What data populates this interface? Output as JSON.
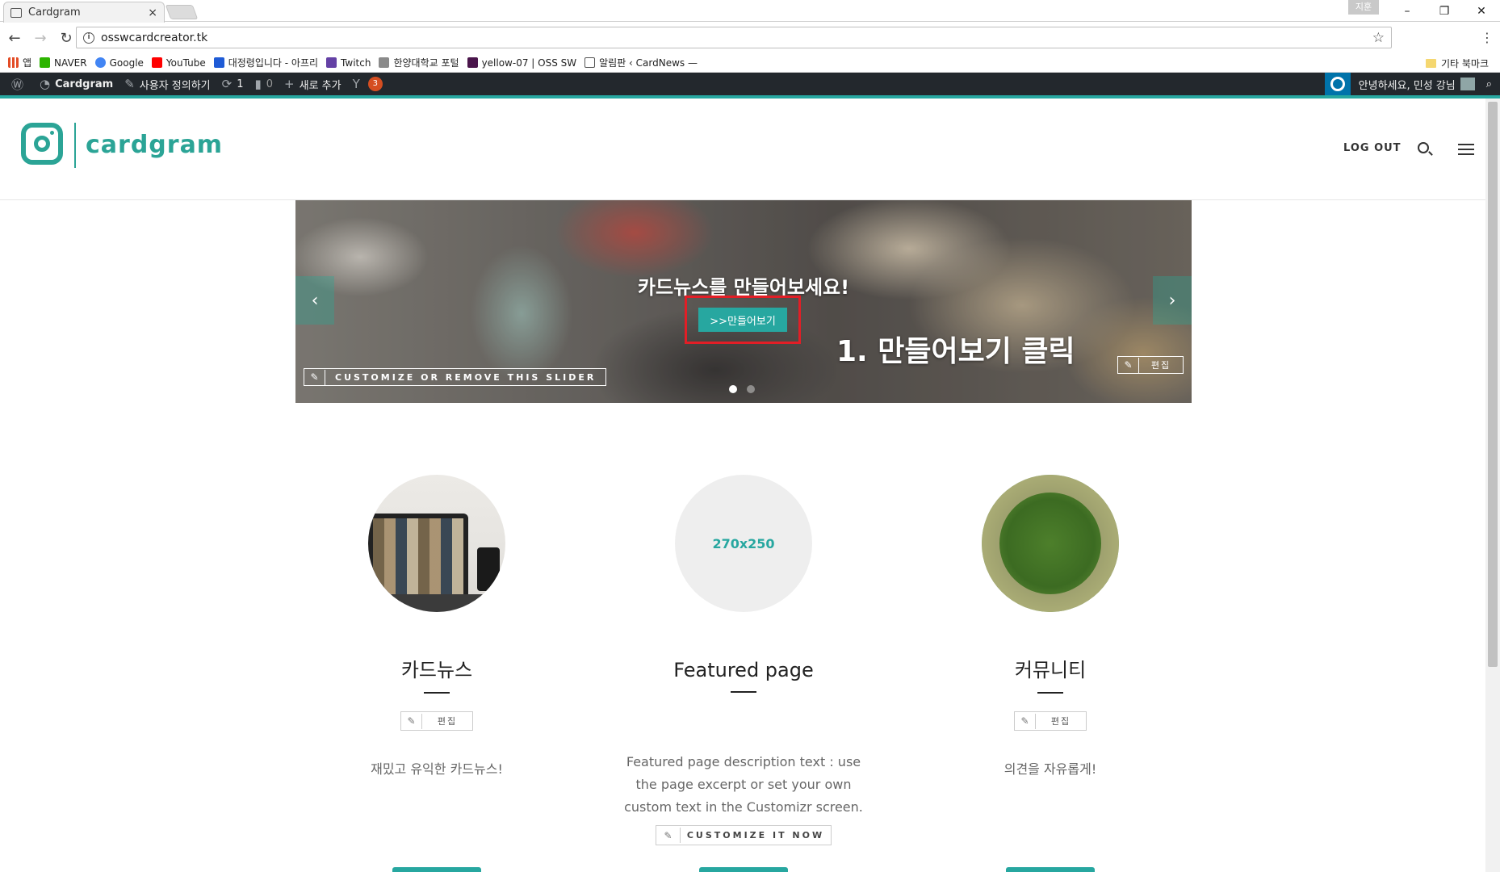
{
  "browser": {
    "tab_title": "Cardgram",
    "tab_close": "×",
    "profile_label": "지훈",
    "url": "osswcardcreator.tk",
    "bookmarks": [
      {
        "label": "앱",
        "color": "#e34c26"
      },
      {
        "label": "NAVER",
        "color": "#2db400"
      },
      {
        "label": "Google",
        "color": "#4285f4"
      },
      {
        "label": "YouTube",
        "color": "#ff0000"
      },
      {
        "label": "대정령입니다 - 아프리",
        "color": "#1f5bd6"
      },
      {
        "label": "Twitch",
        "color": "#6441a5"
      },
      {
        "label": "한양대학교 포털",
        "color": "#8a8a8a"
      },
      {
        "label": "yellow-07 | OSS SW",
        "color": "#4a154b"
      },
      {
        "label": "알림판 ‹ CardNews —",
        "color": "#555555"
      }
    ],
    "other_bookmarks": "기타 북마크"
  },
  "adminbar": {
    "site_name": "Cardgram",
    "customize": "사용자 정의하기",
    "updates_count": "1",
    "comments_count": "0",
    "new_item": "새로 추가",
    "yoast_count": "3",
    "greeting": "안녕하세요, 민성 강님"
  },
  "header": {
    "logo_text": "cardgram",
    "logout": "LOG OUT"
  },
  "slider": {
    "caption": "카드뉴스를 만들어보세요!",
    "cta": ">>만들어보기",
    "annotation": "1. 만들어보기 클릭",
    "customize_slider": "CUSTOMIZE OR REMOVE THIS SLIDER",
    "edit": "편집",
    "prev_arrow": "‹",
    "next_arrow": "›",
    "active_slide": 1,
    "slide_count": 2
  },
  "featured": [
    {
      "title": "카드뉴스",
      "edit": "편집",
      "description": "재밌고 유익한 카드뉴스!",
      "image": "laptop-photo"
    },
    {
      "title": "Featured page",
      "placeholder": "270x250",
      "description": "Featured page description text : use the page excerpt or set your own custom text in the Customizr screen.",
      "customize": "CUSTOMIZE IT NOW"
    },
    {
      "title": "커뮤니티",
      "edit": "편집",
      "description": "의견을 자유롭게!",
      "image": "hands-on-grass-photo"
    }
  ],
  "colors": {
    "accent": "#27a7a0",
    "adminbar": "#23282d",
    "highlight_box": "#e21e26"
  }
}
